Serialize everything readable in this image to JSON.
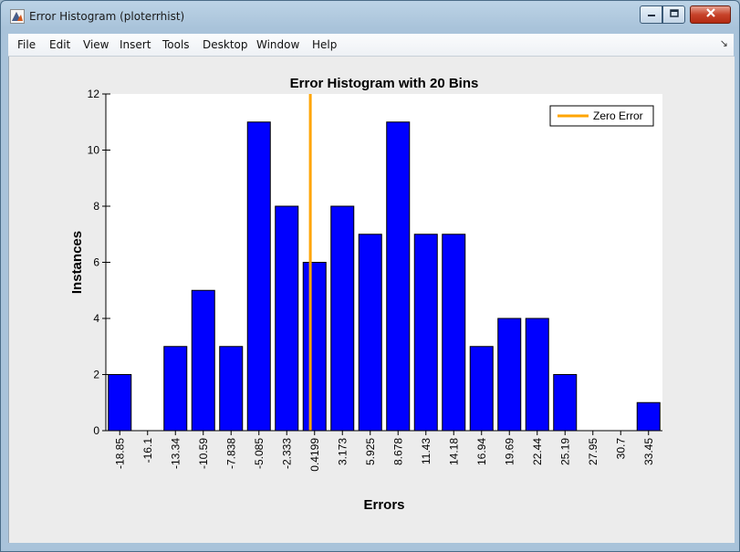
{
  "window": {
    "title": "Error Histogram (ploterrhist)",
    "colors": {
      "frame": "#a9c3da",
      "close": "#c7432a"
    }
  },
  "menu": {
    "items": [
      "File",
      "Edit",
      "View",
      "Insert",
      "Tools",
      "Desktop",
      "Window",
      "Help"
    ]
  },
  "chart_data": {
    "type": "bar",
    "title": "Error Histogram with 20 Bins",
    "xlabel": "Errors",
    "ylabel": "Instances",
    "categories": [
      "-18.85",
      "-16.1",
      "-13.34",
      "-10.59",
      "-7.838",
      "-5.085",
      "-2.333",
      "0.4199",
      "3.173",
      "5.925",
      "8.678",
      "11.43",
      "14.18",
      "16.94",
      "19.69",
      "22.44",
      "25.19",
      "27.95",
      "30.7",
      "33.45"
    ],
    "values": [
      2,
      0,
      3,
      5,
      3,
      11,
      8,
      6,
      8,
      7,
      11,
      7,
      7,
      3,
      4,
      4,
      2,
      0,
      0,
      1
    ],
    "ylim": [
      0,
      12
    ],
    "yticks": [
      0,
      2,
      4,
      6,
      8,
      10,
      12
    ],
    "bar_color": "#0000ff",
    "zero_line": {
      "label": "Zero Error",
      "x_value": 0,
      "color": "#ffa500"
    },
    "legend_placement": "top-right",
    "grid": false
  }
}
